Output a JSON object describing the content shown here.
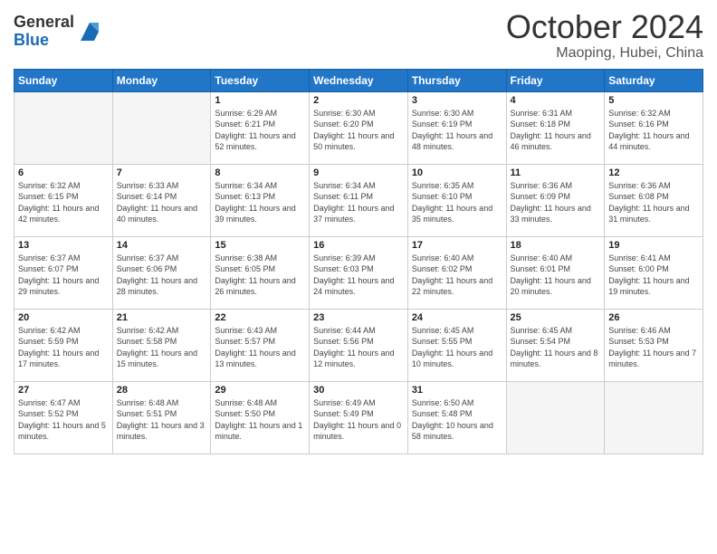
{
  "logo": {
    "line1": "General",
    "line2": "Blue"
  },
  "title": "October 2024",
  "location": "Maoping, Hubei, China",
  "days_of_week": [
    "Sunday",
    "Monday",
    "Tuesday",
    "Wednesday",
    "Thursday",
    "Friday",
    "Saturday"
  ],
  "weeks": [
    [
      {
        "day": "",
        "sunrise": "",
        "sunset": "",
        "daylight": ""
      },
      {
        "day": "",
        "sunrise": "",
        "sunset": "",
        "daylight": ""
      },
      {
        "day": "1",
        "sunrise": "Sunrise: 6:29 AM",
        "sunset": "Sunset: 6:21 PM",
        "daylight": "Daylight: 11 hours and 52 minutes."
      },
      {
        "day": "2",
        "sunrise": "Sunrise: 6:30 AM",
        "sunset": "Sunset: 6:20 PM",
        "daylight": "Daylight: 11 hours and 50 minutes."
      },
      {
        "day": "3",
        "sunrise": "Sunrise: 6:30 AM",
        "sunset": "Sunset: 6:19 PM",
        "daylight": "Daylight: 11 hours and 48 minutes."
      },
      {
        "day": "4",
        "sunrise": "Sunrise: 6:31 AM",
        "sunset": "Sunset: 6:18 PM",
        "daylight": "Daylight: 11 hours and 46 minutes."
      },
      {
        "day": "5",
        "sunrise": "Sunrise: 6:32 AM",
        "sunset": "Sunset: 6:16 PM",
        "daylight": "Daylight: 11 hours and 44 minutes."
      }
    ],
    [
      {
        "day": "6",
        "sunrise": "Sunrise: 6:32 AM",
        "sunset": "Sunset: 6:15 PM",
        "daylight": "Daylight: 11 hours and 42 minutes."
      },
      {
        "day": "7",
        "sunrise": "Sunrise: 6:33 AM",
        "sunset": "Sunset: 6:14 PM",
        "daylight": "Daylight: 11 hours and 40 minutes."
      },
      {
        "day": "8",
        "sunrise": "Sunrise: 6:34 AM",
        "sunset": "Sunset: 6:13 PM",
        "daylight": "Daylight: 11 hours and 39 minutes."
      },
      {
        "day": "9",
        "sunrise": "Sunrise: 6:34 AM",
        "sunset": "Sunset: 6:11 PM",
        "daylight": "Daylight: 11 hours and 37 minutes."
      },
      {
        "day": "10",
        "sunrise": "Sunrise: 6:35 AM",
        "sunset": "Sunset: 6:10 PM",
        "daylight": "Daylight: 11 hours and 35 minutes."
      },
      {
        "day": "11",
        "sunrise": "Sunrise: 6:36 AM",
        "sunset": "Sunset: 6:09 PM",
        "daylight": "Daylight: 11 hours and 33 minutes."
      },
      {
        "day": "12",
        "sunrise": "Sunrise: 6:36 AM",
        "sunset": "Sunset: 6:08 PM",
        "daylight": "Daylight: 11 hours and 31 minutes."
      }
    ],
    [
      {
        "day": "13",
        "sunrise": "Sunrise: 6:37 AM",
        "sunset": "Sunset: 6:07 PM",
        "daylight": "Daylight: 11 hours and 29 minutes."
      },
      {
        "day": "14",
        "sunrise": "Sunrise: 6:37 AM",
        "sunset": "Sunset: 6:06 PM",
        "daylight": "Daylight: 11 hours and 28 minutes."
      },
      {
        "day": "15",
        "sunrise": "Sunrise: 6:38 AM",
        "sunset": "Sunset: 6:05 PM",
        "daylight": "Daylight: 11 hours and 26 minutes."
      },
      {
        "day": "16",
        "sunrise": "Sunrise: 6:39 AM",
        "sunset": "Sunset: 6:03 PM",
        "daylight": "Daylight: 11 hours and 24 minutes."
      },
      {
        "day": "17",
        "sunrise": "Sunrise: 6:40 AM",
        "sunset": "Sunset: 6:02 PM",
        "daylight": "Daylight: 11 hours and 22 minutes."
      },
      {
        "day": "18",
        "sunrise": "Sunrise: 6:40 AM",
        "sunset": "Sunset: 6:01 PM",
        "daylight": "Daylight: 11 hours and 20 minutes."
      },
      {
        "day": "19",
        "sunrise": "Sunrise: 6:41 AM",
        "sunset": "Sunset: 6:00 PM",
        "daylight": "Daylight: 11 hours and 19 minutes."
      }
    ],
    [
      {
        "day": "20",
        "sunrise": "Sunrise: 6:42 AM",
        "sunset": "Sunset: 5:59 PM",
        "daylight": "Daylight: 11 hours and 17 minutes."
      },
      {
        "day": "21",
        "sunrise": "Sunrise: 6:42 AM",
        "sunset": "Sunset: 5:58 PM",
        "daylight": "Daylight: 11 hours and 15 minutes."
      },
      {
        "day": "22",
        "sunrise": "Sunrise: 6:43 AM",
        "sunset": "Sunset: 5:57 PM",
        "daylight": "Daylight: 11 hours and 13 minutes."
      },
      {
        "day": "23",
        "sunrise": "Sunrise: 6:44 AM",
        "sunset": "Sunset: 5:56 PM",
        "daylight": "Daylight: 11 hours and 12 minutes."
      },
      {
        "day": "24",
        "sunrise": "Sunrise: 6:45 AM",
        "sunset": "Sunset: 5:55 PM",
        "daylight": "Daylight: 11 hours and 10 minutes."
      },
      {
        "day": "25",
        "sunrise": "Sunrise: 6:45 AM",
        "sunset": "Sunset: 5:54 PM",
        "daylight": "Daylight: 11 hours and 8 minutes."
      },
      {
        "day": "26",
        "sunrise": "Sunrise: 6:46 AM",
        "sunset": "Sunset: 5:53 PM",
        "daylight": "Daylight: 11 hours and 7 minutes."
      }
    ],
    [
      {
        "day": "27",
        "sunrise": "Sunrise: 6:47 AM",
        "sunset": "Sunset: 5:52 PM",
        "daylight": "Daylight: 11 hours and 5 minutes."
      },
      {
        "day": "28",
        "sunrise": "Sunrise: 6:48 AM",
        "sunset": "Sunset: 5:51 PM",
        "daylight": "Daylight: 11 hours and 3 minutes."
      },
      {
        "day": "29",
        "sunrise": "Sunrise: 6:48 AM",
        "sunset": "Sunset: 5:50 PM",
        "daylight": "Daylight: 11 hours and 1 minute."
      },
      {
        "day": "30",
        "sunrise": "Sunrise: 6:49 AM",
        "sunset": "Sunset: 5:49 PM",
        "daylight": "Daylight: 11 hours and 0 minutes."
      },
      {
        "day": "31",
        "sunrise": "Sunrise: 6:50 AM",
        "sunset": "Sunset: 5:48 PM",
        "daylight": "Daylight: 10 hours and 58 minutes."
      },
      {
        "day": "",
        "sunrise": "",
        "sunset": "",
        "daylight": ""
      },
      {
        "day": "",
        "sunrise": "",
        "sunset": "",
        "daylight": ""
      }
    ]
  ]
}
